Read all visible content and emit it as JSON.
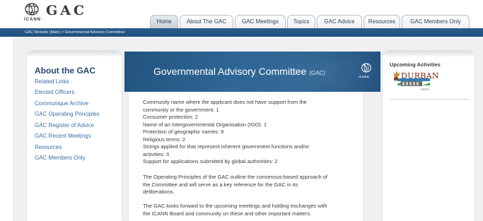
{
  "header": {
    "logo_title": "GAC",
    "logo_org": "ICANN"
  },
  "nav": {
    "tabs": [
      {
        "label": "Home",
        "active": true
      },
      {
        "label": "About The GAC",
        "active": false
      },
      {
        "label": "GAC Meetings",
        "active": false
      },
      {
        "label": "Topics",
        "active": false
      },
      {
        "label": "GAC Advice",
        "active": false
      },
      {
        "label": "Resources",
        "active": false
      },
      {
        "label": "GAC Members Only",
        "active": false
      }
    ]
  },
  "breadcrumb": "GAC Website (Main) > Governmental Advisory Committee",
  "sidebar": {
    "title": "About the GAC",
    "items": [
      {
        "label": "Related Links"
      },
      {
        "label": "Elected Officers"
      },
      {
        "label": "Communique Archive"
      },
      {
        "label": "GAC Operating Principles"
      },
      {
        "label": "GAC Register of Advice"
      },
      {
        "label": "GAC Recent Meetings"
      },
      {
        "label": "Resources"
      },
      {
        "label": "GAC Members Only"
      }
    ]
  },
  "banner": {
    "title": "Governmental Advisory Committee",
    "abbr": "(GAC)",
    "logo_text": "ICANN"
  },
  "main": {
    "stats_lines": [
      "Community name where the applicant does not have support from the",
      "community or the government: 1",
      "Consumer protection: 2",
      "Name of an Intergovernmental Organisation (IGO): 1",
      "Protection of geographic names: 9",
      "Religious terms: 2",
      "Strings applied for that represent inherent government functions and/or",
      "activities: 3",
      "Support for applications submitted by global authorities: 2"
    ],
    "para1_lines": [
      "The Operating Principles of the GAC outline the consensus-based approach of",
      "the Committee and will serve as a key reference for the GAC in its",
      "deliberations."
    ],
    "para2_lines": [
      "The GAC looks forward to the upcoming meetings and holding exchanges with",
      "the ICANN Board and community on these and other important matters."
    ]
  },
  "right_sidebar": {
    "title": "Upcoming Activities",
    "event_logo_text": "DURBAN"
  },
  "colors": {
    "topbar": "#245785",
    "banner": "#2a5e8e",
    "link": "#3a6ea5",
    "heading": "#27496d"
  }
}
